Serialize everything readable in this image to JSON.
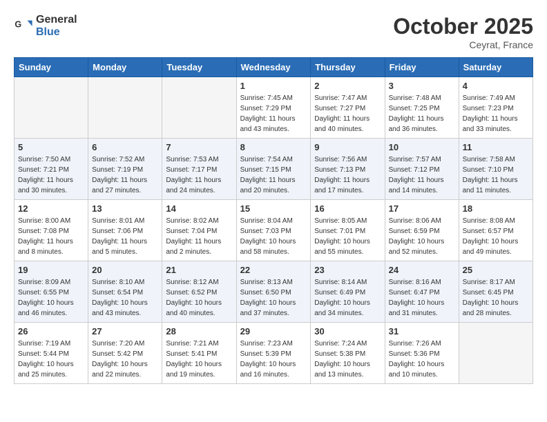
{
  "header": {
    "logo_general": "General",
    "logo_blue": "Blue",
    "month": "October 2025",
    "location": "Ceyrat, France"
  },
  "weekdays": [
    "Sunday",
    "Monday",
    "Tuesday",
    "Wednesday",
    "Thursday",
    "Friday",
    "Saturday"
  ],
  "weeks": [
    [
      {
        "day": "",
        "info": ""
      },
      {
        "day": "",
        "info": ""
      },
      {
        "day": "",
        "info": ""
      },
      {
        "day": "1",
        "info": "Sunrise: 7:45 AM\nSunset: 7:29 PM\nDaylight: 11 hours\nand 43 minutes."
      },
      {
        "day": "2",
        "info": "Sunrise: 7:47 AM\nSunset: 7:27 PM\nDaylight: 11 hours\nand 40 minutes."
      },
      {
        "day": "3",
        "info": "Sunrise: 7:48 AM\nSunset: 7:25 PM\nDaylight: 11 hours\nand 36 minutes."
      },
      {
        "day": "4",
        "info": "Sunrise: 7:49 AM\nSunset: 7:23 PM\nDaylight: 11 hours\nand 33 minutes."
      }
    ],
    [
      {
        "day": "5",
        "info": "Sunrise: 7:50 AM\nSunset: 7:21 PM\nDaylight: 11 hours\nand 30 minutes."
      },
      {
        "day": "6",
        "info": "Sunrise: 7:52 AM\nSunset: 7:19 PM\nDaylight: 11 hours\nand 27 minutes."
      },
      {
        "day": "7",
        "info": "Sunrise: 7:53 AM\nSunset: 7:17 PM\nDaylight: 11 hours\nand 24 minutes."
      },
      {
        "day": "8",
        "info": "Sunrise: 7:54 AM\nSunset: 7:15 PM\nDaylight: 11 hours\nand 20 minutes."
      },
      {
        "day": "9",
        "info": "Sunrise: 7:56 AM\nSunset: 7:13 PM\nDaylight: 11 hours\nand 17 minutes."
      },
      {
        "day": "10",
        "info": "Sunrise: 7:57 AM\nSunset: 7:12 PM\nDaylight: 11 hours\nand 14 minutes."
      },
      {
        "day": "11",
        "info": "Sunrise: 7:58 AM\nSunset: 7:10 PM\nDaylight: 11 hours\nand 11 minutes."
      }
    ],
    [
      {
        "day": "12",
        "info": "Sunrise: 8:00 AM\nSunset: 7:08 PM\nDaylight: 11 hours\nand 8 minutes."
      },
      {
        "day": "13",
        "info": "Sunrise: 8:01 AM\nSunset: 7:06 PM\nDaylight: 11 hours\nand 5 minutes."
      },
      {
        "day": "14",
        "info": "Sunrise: 8:02 AM\nSunset: 7:04 PM\nDaylight: 11 hours\nand 2 minutes."
      },
      {
        "day": "15",
        "info": "Sunrise: 8:04 AM\nSunset: 7:03 PM\nDaylight: 10 hours\nand 58 minutes."
      },
      {
        "day": "16",
        "info": "Sunrise: 8:05 AM\nSunset: 7:01 PM\nDaylight: 10 hours\nand 55 minutes."
      },
      {
        "day": "17",
        "info": "Sunrise: 8:06 AM\nSunset: 6:59 PM\nDaylight: 10 hours\nand 52 minutes."
      },
      {
        "day": "18",
        "info": "Sunrise: 8:08 AM\nSunset: 6:57 PM\nDaylight: 10 hours\nand 49 minutes."
      }
    ],
    [
      {
        "day": "19",
        "info": "Sunrise: 8:09 AM\nSunset: 6:55 PM\nDaylight: 10 hours\nand 46 minutes."
      },
      {
        "day": "20",
        "info": "Sunrise: 8:10 AM\nSunset: 6:54 PM\nDaylight: 10 hours\nand 43 minutes."
      },
      {
        "day": "21",
        "info": "Sunrise: 8:12 AM\nSunset: 6:52 PM\nDaylight: 10 hours\nand 40 minutes."
      },
      {
        "day": "22",
        "info": "Sunrise: 8:13 AM\nSunset: 6:50 PM\nDaylight: 10 hours\nand 37 minutes."
      },
      {
        "day": "23",
        "info": "Sunrise: 8:14 AM\nSunset: 6:49 PM\nDaylight: 10 hours\nand 34 minutes."
      },
      {
        "day": "24",
        "info": "Sunrise: 8:16 AM\nSunset: 6:47 PM\nDaylight: 10 hours\nand 31 minutes."
      },
      {
        "day": "25",
        "info": "Sunrise: 8:17 AM\nSunset: 6:45 PM\nDaylight: 10 hours\nand 28 minutes."
      }
    ],
    [
      {
        "day": "26",
        "info": "Sunrise: 7:19 AM\nSunset: 5:44 PM\nDaylight: 10 hours\nand 25 minutes."
      },
      {
        "day": "27",
        "info": "Sunrise: 7:20 AM\nSunset: 5:42 PM\nDaylight: 10 hours\nand 22 minutes."
      },
      {
        "day": "28",
        "info": "Sunrise: 7:21 AM\nSunset: 5:41 PM\nDaylight: 10 hours\nand 19 minutes."
      },
      {
        "day": "29",
        "info": "Sunrise: 7:23 AM\nSunset: 5:39 PM\nDaylight: 10 hours\nand 16 minutes."
      },
      {
        "day": "30",
        "info": "Sunrise: 7:24 AM\nSunset: 5:38 PM\nDaylight: 10 hours\nand 13 minutes."
      },
      {
        "day": "31",
        "info": "Sunrise: 7:26 AM\nSunset: 5:36 PM\nDaylight: 10 hours\nand 10 minutes."
      },
      {
        "day": "",
        "info": ""
      }
    ]
  ]
}
